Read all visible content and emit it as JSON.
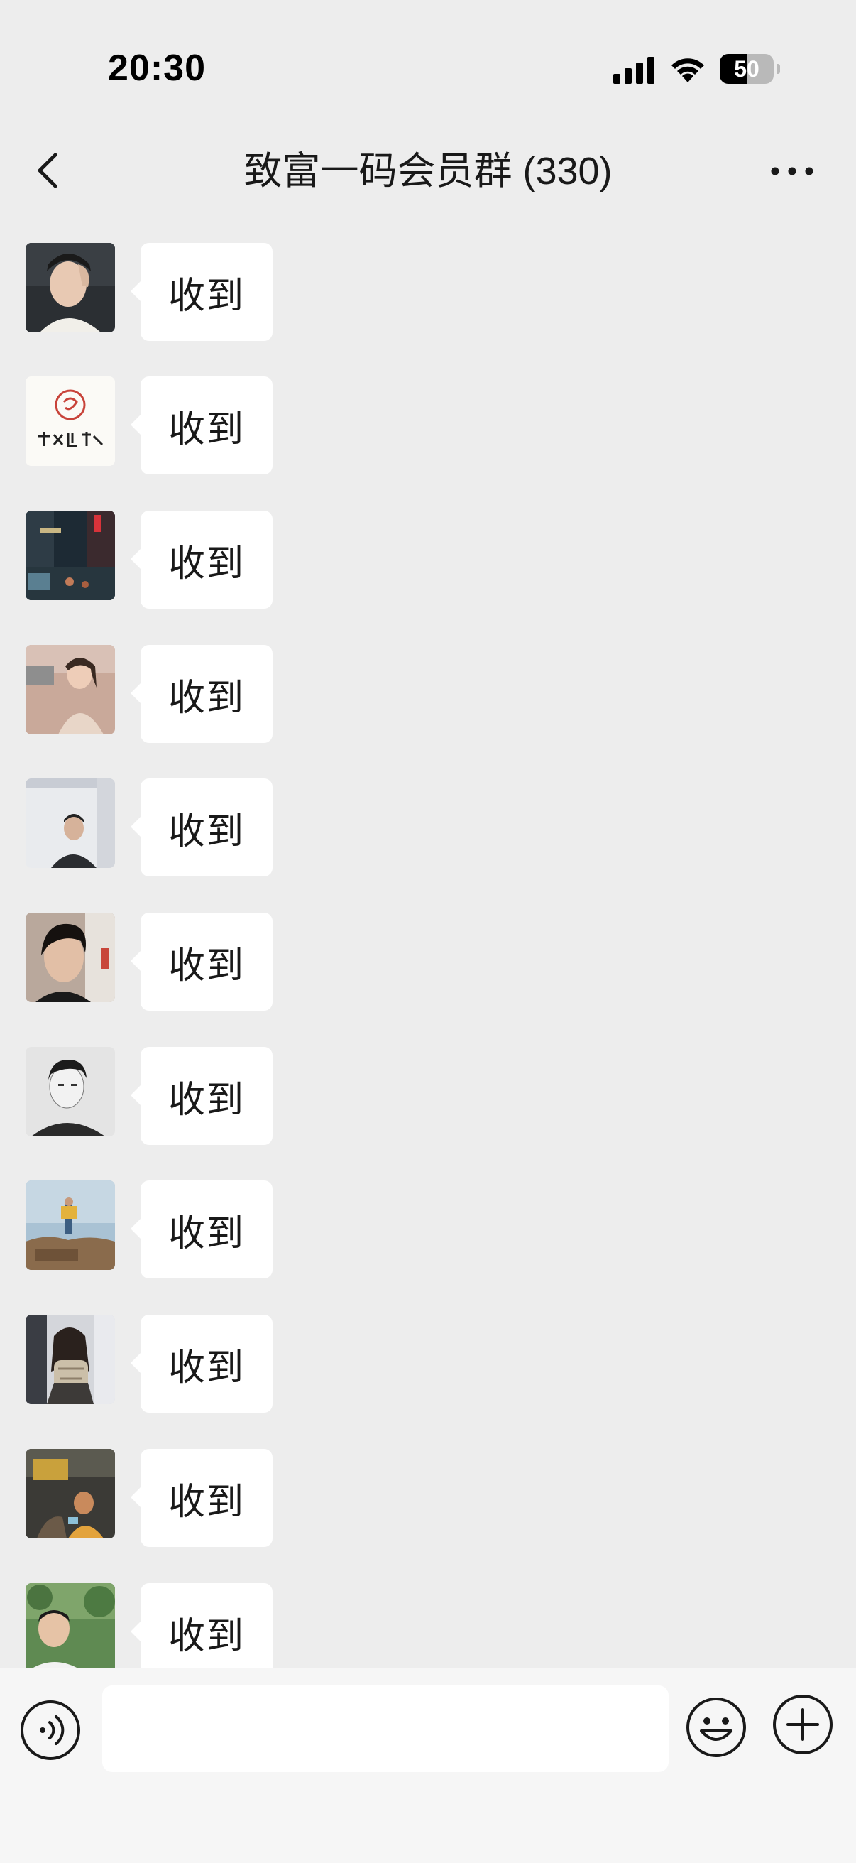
{
  "status_bar": {
    "time": "20:30",
    "battery_level": "50",
    "battery_fraction": 0.5,
    "signal_icon": "signal-bars-icon",
    "wifi_icon": "wifi-icon"
  },
  "nav": {
    "title": "致富一码会员群 (330)",
    "back_icon": "chevron-left-icon",
    "more_icon": "more-dots-icon"
  },
  "messages": [
    {
      "text": "收到",
      "avatar": "avatar-1"
    },
    {
      "text": "收到",
      "avatar": "avatar-2"
    },
    {
      "text": "收到",
      "avatar": "avatar-3"
    },
    {
      "text": "收到",
      "avatar": "avatar-4"
    },
    {
      "text": "收到",
      "avatar": "avatar-5"
    },
    {
      "text": "收到",
      "avatar": "avatar-6"
    },
    {
      "text": "收到",
      "avatar": "avatar-7"
    },
    {
      "text": "收到",
      "avatar": "avatar-8"
    },
    {
      "text": "收到",
      "avatar": "avatar-9"
    },
    {
      "text": "收到",
      "avatar": "avatar-10"
    },
    {
      "text": "收到",
      "avatar": "avatar-11"
    }
  ],
  "input_bar": {
    "value": "",
    "placeholder": "",
    "voice_icon": "voice-icon",
    "emoji_icon": "emoji-icon",
    "plus_icon": "plus-circle-icon"
  },
  "colors": {
    "background": "#ededed",
    "bubble": "#ffffff",
    "text": "#191919",
    "input_bar": "#f6f6f6"
  }
}
